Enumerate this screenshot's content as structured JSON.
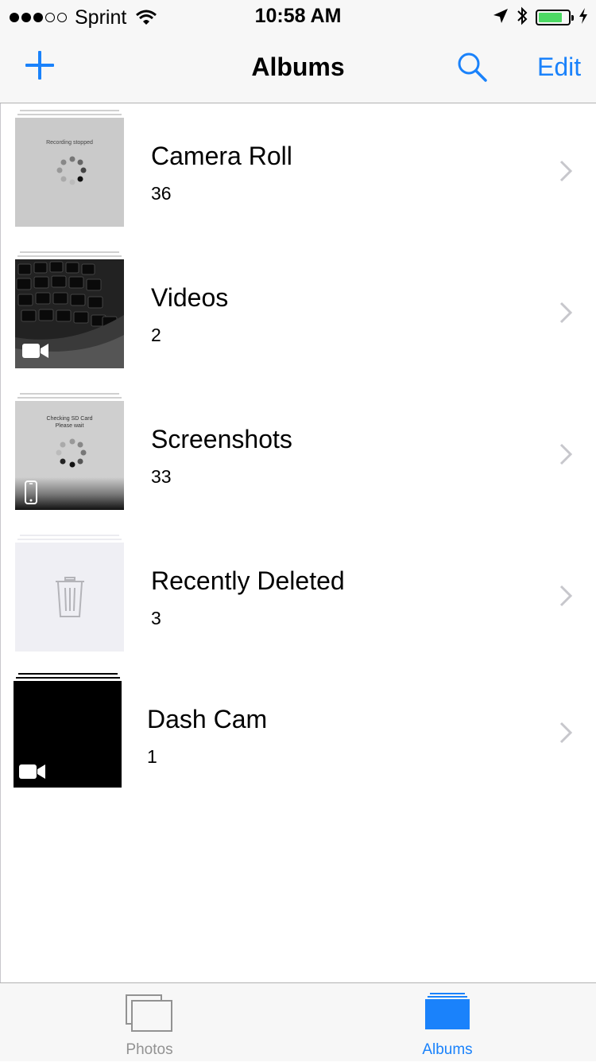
{
  "status_bar": {
    "carrier": "Sprint",
    "time": "10:58 AM",
    "signal_bars_filled": 3,
    "signal_bars_total": 5,
    "battery_level": 0.8,
    "battery_color": "#4cd964"
  },
  "nav": {
    "title": "Albums",
    "edit_label": "Edit",
    "accent_color": "#1a82fb"
  },
  "albums": [
    {
      "name": "Camera Roll",
      "count": "36",
      "thumb_caption": "Recording stopped"
    },
    {
      "name": "Videos",
      "count": "2"
    },
    {
      "name": "Screenshots",
      "count": "33",
      "thumb_caption_1": "Checking SD Card",
      "thumb_caption_2": "Please wait"
    },
    {
      "name": "Recently Deleted",
      "count": "3"
    },
    {
      "name": "Dash Cam",
      "count": "1"
    }
  ],
  "tabs": [
    {
      "label": "Photos",
      "selected": false
    },
    {
      "label": "Albums",
      "selected": true
    }
  ]
}
